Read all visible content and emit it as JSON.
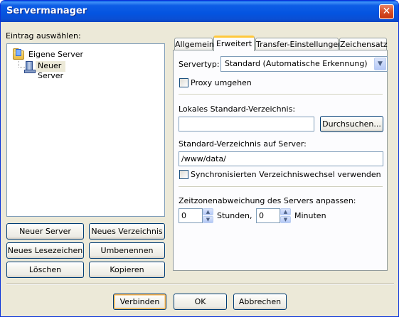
{
  "window": {
    "title": "Servermanager",
    "close_symbol": "✕"
  },
  "left": {
    "label": "Eintrag auswählen:",
    "tree": {
      "root": "Eigene Server",
      "child": "Neuer Server"
    },
    "buttons": {
      "new_server": "Neuer Server",
      "new_folder": "Neues Verzeichnis",
      "new_bookmark": "Neues Lesezeichen",
      "rename": "Umbenennen",
      "delete": "Löschen",
      "copy": "Kopieren"
    }
  },
  "tabs": [
    "Allgemein",
    "Erweitert",
    "Transfer-Einstellungen",
    "Zeichensatz"
  ],
  "advanced": {
    "servertype_label": "Servertyp:",
    "servertype_value": "Standard (Automatische Erkennung)",
    "bypass_proxy": "Proxy umgehen",
    "local_dir_label": "Lokales Standard-Verzeichnis:",
    "local_dir_value": "",
    "browse_button": "Durchsuchen...",
    "remote_dir_label": "Standard-Verzeichnis auf Server:",
    "remote_dir_value": "/www/data/",
    "sync_browsing": "Synchronisierten Verzeichniswechsel verwenden",
    "timezone_label": "Zeitzonenabweichung des Servers anpassen:",
    "hours_value": "0",
    "hours_label": "Stunden,",
    "minutes_value": "0",
    "minutes_label": "Minuten"
  },
  "footer": {
    "connect": "Verbinden",
    "ok": "OK",
    "cancel": "Abbrechen"
  }
}
